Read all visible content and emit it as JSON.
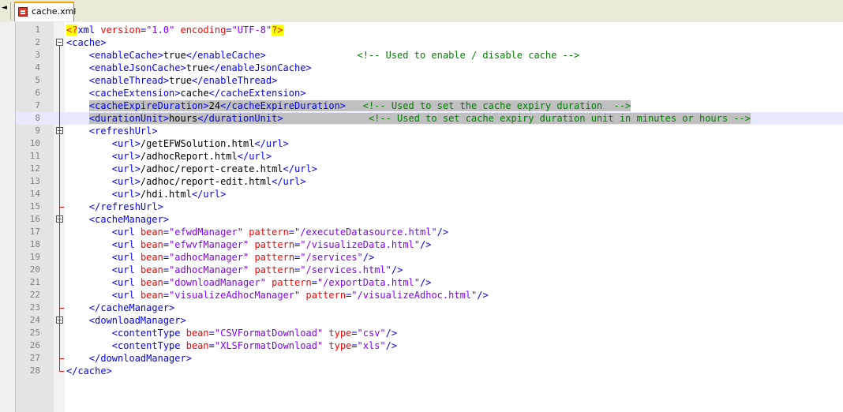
{
  "tab": {
    "label": "cache.xml",
    "icon": "xml-file-icon",
    "scroll_left_glyph": "◄"
  },
  "colors": {
    "tag": "#0000ff",
    "attribute": "#ff0000",
    "value": "#8000ff",
    "comment": "#008000",
    "fold": "#e81717"
  },
  "lines": [
    {
      "n": "1",
      "tokens": [
        [
          "pi",
          "<?"
        ],
        [
          "tag",
          "xml"
        ],
        [
          "txt",
          " "
        ],
        [
          "attr",
          "version"
        ],
        [
          "tag",
          "="
        ],
        [
          "val",
          "\"1.0\""
        ],
        [
          "txt",
          " "
        ],
        [
          "attr",
          "encoding"
        ],
        [
          "tag",
          "="
        ],
        [
          "val",
          "\"UTF-8\""
        ],
        [
          "pi",
          "?>"
        ]
      ]
    },
    {
      "n": "2",
      "fold": "open",
      "tokens": [
        [
          "tag",
          "<cache>"
        ]
      ]
    },
    {
      "n": "3",
      "tokens": [
        [
          "txt",
          "    "
        ],
        [
          "tag",
          "<enableCache>"
        ],
        [
          "txt",
          "true"
        ],
        [
          "tag",
          "</enableCache>"
        ],
        [
          "txt",
          "                "
        ],
        [
          "com",
          "<!-- Used to enable / disable cache -->"
        ]
      ]
    },
    {
      "n": "4",
      "tokens": [
        [
          "txt",
          "    "
        ],
        [
          "tag",
          "<enableJsonCache>"
        ],
        [
          "txt",
          "true"
        ],
        [
          "tag",
          "</enableJsonCache>"
        ]
      ]
    },
    {
      "n": "5",
      "tokens": [
        [
          "txt",
          "    "
        ],
        [
          "tag",
          "<enableThread>"
        ],
        [
          "txt",
          "true"
        ],
        [
          "tag",
          "</enableThread>"
        ]
      ]
    },
    {
      "n": "6",
      "tokens": [
        [
          "txt",
          "    "
        ],
        [
          "tag",
          "<cacheExtension>"
        ],
        [
          "txt",
          "cache"
        ],
        [
          "tag",
          "</cacheExtension>"
        ]
      ]
    },
    {
      "n": "7",
      "sel": true,
      "tokens": [
        [
          "txt",
          "    "
        ],
        [
          "tag",
          "<cacheExpireDuration>"
        ],
        [
          "txt",
          "24"
        ],
        [
          "tag",
          "</cacheExpireDuration>"
        ],
        [
          "txt",
          "   "
        ],
        [
          "com",
          "<!-- Used to set the cache expiry duration  -->"
        ]
      ]
    },
    {
      "n": "8",
      "sel": true,
      "current": true,
      "tokens": [
        [
          "txt",
          "    "
        ],
        [
          "tag",
          "<durationUnit>"
        ],
        [
          "txt",
          "hours"
        ],
        [
          "tag",
          "</durationUnit>"
        ],
        [
          "txt",
          "               "
        ],
        [
          "com",
          "<!-- Used to set cache expiry duration unit in minutes or hours -->"
        ]
      ]
    },
    {
      "n": "9",
      "fold": "open",
      "tokens": [
        [
          "txt",
          "    "
        ],
        [
          "tag",
          "<refreshUrl>"
        ]
      ]
    },
    {
      "n": "10",
      "tokens": [
        [
          "txt",
          "        "
        ],
        [
          "tag",
          "<url>"
        ],
        [
          "txt",
          "/getEFWSolution.html"
        ],
        [
          "tag",
          "</url>"
        ]
      ]
    },
    {
      "n": "11",
      "tokens": [
        [
          "txt",
          "        "
        ],
        [
          "tag",
          "<url>"
        ],
        [
          "txt",
          "/adhocReport.html"
        ],
        [
          "tag",
          "</url>"
        ]
      ]
    },
    {
      "n": "12",
      "tokens": [
        [
          "txt",
          "        "
        ],
        [
          "tag",
          "<url>"
        ],
        [
          "txt",
          "/adhoc/report-create.html"
        ],
        [
          "tag",
          "</url>"
        ]
      ]
    },
    {
      "n": "13",
      "tokens": [
        [
          "txt",
          "        "
        ],
        [
          "tag",
          "<url>"
        ],
        [
          "txt",
          "/adhoc/report-edit.html"
        ],
        [
          "tag",
          "</url>"
        ]
      ]
    },
    {
      "n": "14",
      "tokens": [
        [
          "txt",
          "        "
        ],
        [
          "tag",
          "<url>"
        ],
        [
          "txt",
          "/hdi.html"
        ],
        [
          "tag",
          "</url>"
        ]
      ]
    },
    {
      "n": "15",
      "foldEnd": true,
      "tokens": [
        [
          "txt",
          "    "
        ],
        [
          "tag",
          "</refreshUrl>"
        ]
      ]
    },
    {
      "n": "16",
      "fold": "open",
      "tokens": [
        [
          "txt",
          "    "
        ],
        [
          "tag",
          "<cacheManager>"
        ]
      ]
    },
    {
      "n": "17",
      "tokens": [
        [
          "txt",
          "        "
        ],
        [
          "tag",
          "<url"
        ],
        [
          "txt",
          " "
        ],
        [
          "attr",
          "bean"
        ],
        [
          "tag",
          "="
        ],
        [
          "val",
          "\"efwdManager\""
        ],
        [
          "txt",
          " "
        ],
        [
          "attr",
          "pattern"
        ],
        [
          "tag",
          "="
        ],
        [
          "val",
          "\"/executeDatasource.html\""
        ],
        [
          "tag",
          "/>"
        ]
      ]
    },
    {
      "n": "18",
      "tokens": [
        [
          "txt",
          "        "
        ],
        [
          "tag",
          "<url"
        ],
        [
          "txt",
          " "
        ],
        [
          "attr",
          "bean"
        ],
        [
          "tag",
          "="
        ],
        [
          "val",
          "\"efwvfManager\""
        ],
        [
          "txt",
          " "
        ],
        [
          "attr",
          "pattern"
        ],
        [
          "tag",
          "="
        ],
        [
          "val",
          "\"/visualizeData.html\""
        ],
        [
          "tag",
          "/>"
        ]
      ]
    },
    {
      "n": "19",
      "tokens": [
        [
          "txt",
          "        "
        ],
        [
          "tag",
          "<url"
        ],
        [
          "txt",
          " "
        ],
        [
          "attr",
          "bean"
        ],
        [
          "tag",
          "="
        ],
        [
          "val",
          "\"adhocManager\""
        ],
        [
          "txt",
          " "
        ],
        [
          "attr",
          "pattern"
        ],
        [
          "tag",
          "="
        ],
        [
          "val",
          "\"/services\""
        ],
        [
          "tag",
          "/>"
        ]
      ]
    },
    {
      "n": "20",
      "tokens": [
        [
          "txt",
          "        "
        ],
        [
          "tag",
          "<url"
        ],
        [
          "txt",
          " "
        ],
        [
          "attr",
          "bean"
        ],
        [
          "tag",
          "="
        ],
        [
          "val",
          "\"adhocManager\""
        ],
        [
          "txt",
          " "
        ],
        [
          "attr",
          "pattern"
        ],
        [
          "tag",
          "="
        ],
        [
          "val",
          "\"/services.html\""
        ],
        [
          "tag",
          "/>"
        ]
      ]
    },
    {
      "n": "21",
      "tokens": [
        [
          "txt",
          "        "
        ],
        [
          "tag",
          "<url"
        ],
        [
          "txt",
          " "
        ],
        [
          "attr",
          "bean"
        ],
        [
          "tag",
          "="
        ],
        [
          "val",
          "\"downloadManager\""
        ],
        [
          "txt",
          " "
        ],
        [
          "attr",
          "pattern"
        ],
        [
          "tag",
          "="
        ],
        [
          "val",
          "\"/exportData.html\""
        ],
        [
          "tag",
          "/>"
        ]
      ]
    },
    {
      "n": "22",
      "tokens": [
        [
          "txt",
          "        "
        ],
        [
          "tag",
          "<url"
        ],
        [
          "txt",
          " "
        ],
        [
          "attr",
          "bean"
        ],
        [
          "tag",
          "="
        ],
        [
          "val",
          "\"visualizeAdhocManager\""
        ],
        [
          "txt",
          " "
        ],
        [
          "attr",
          "pattern"
        ],
        [
          "tag",
          "="
        ],
        [
          "val",
          "\"/visualizeAdhoc.html\""
        ],
        [
          "tag",
          "/>"
        ]
      ]
    },
    {
      "n": "23",
      "foldEnd": true,
      "tokens": [
        [
          "txt",
          "    "
        ],
        [
          "tag",
          "</cacheManager>"
        ]
      ]
    },
    {
      "n": "24",
      "fold": "open",
      "tokens": [
        [
          "txt",
          "    "
        ],
        [
          "tag",
          "<downloadManager>"
        ]
      ]
    },
    {
      "n": "25",
      "tokens": [
        [
          "txt",
          "        "
        ],
        [
          "tag",
          "<contentType"
        ],
        [
          "txt",
          " "
        ],
        [
          "attr",
          "bean"
        ],
        [
          "tag",
          "="
        ],
        [
          "val",
          "\"CSVFormatDownload\""
        ],
        [
          "txt",
          " "
        ],
        [
          "attr",
          "type"
        ],
        [
          "tag",
          "="
        ],
        [
          "val",
          "\"csv\""
        ],
        [
          "tag",
          "/>"
        ]
      ]
    },
    {
      "n": "26",
      "tokens": [
        [
          "txt",
          "        "
        ],
        [
          "tag",
          "<contentType"
        ],
        [
          "txt",
          " "
        ],
        [
          "attr",
          "bean"
        ],
        [
          "tag",
          "="
        ],
        [
          "val",
          "\"XLSFormatDownload\""
        ],
        [
          "txt",
          " "
        ],
        [
          "attr",
          "type"
        ],
        [
          "tag",
          "="
        ],
        [
          "val",
          "\"xls\""
        ],
        [
          "tag",
          "/>"
        ]
      ]
    },
    {
      "n": "27",
      "foldEnd": true,
      "tokens": [
        [
          "txt",
          "    "
        ],
        [
          "tag",
          "</downloadManager>"
        ]
      ]
    },
    {
      "n": "28",
      "foldEnd": true,
      "tokens": [
        [
          "tag",
          "</cache>"
        ]
      ]
    }
  ]
}
